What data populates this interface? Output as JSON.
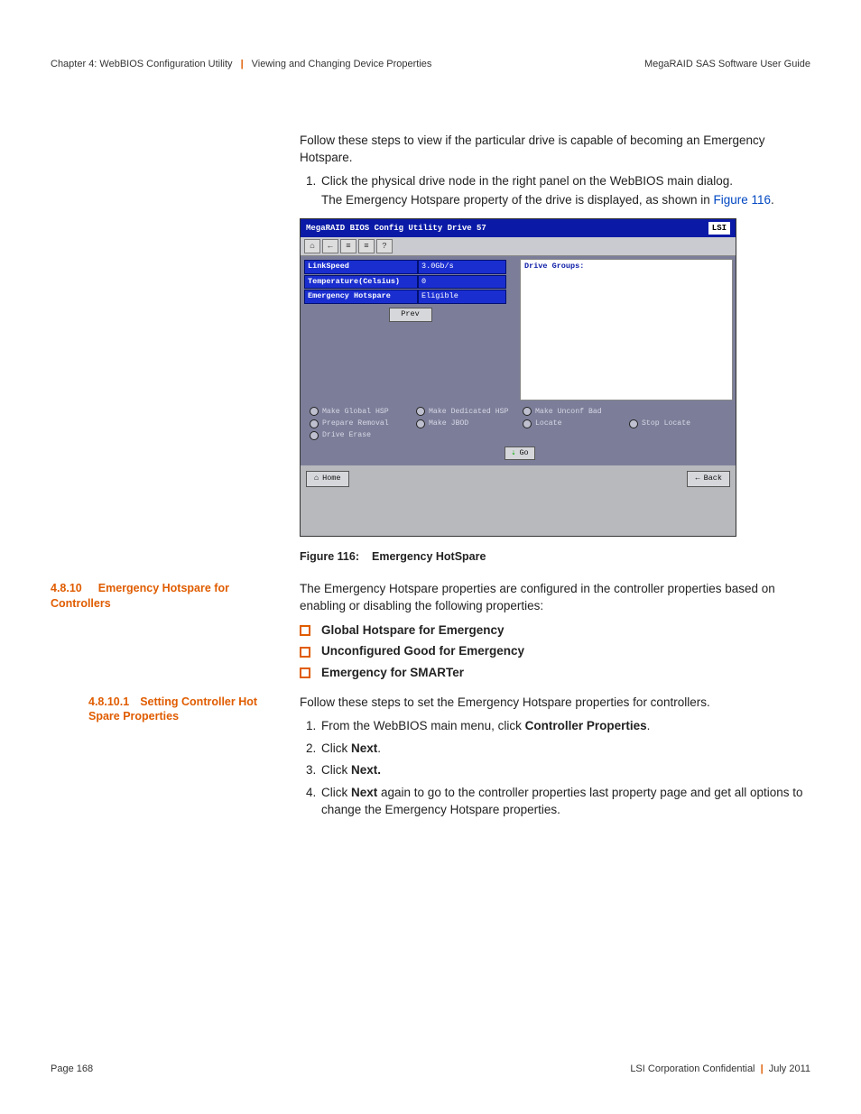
{
  "header": {
    "chapter": "Chapter 4: WebBIOS Configuration Utility",
    "section": "Viewing and Changing Device Properties",
    "doc_title": "MegaRAID SAS Software User Guide"
  },
  "intro": {
    "p1": "Follow these steps to view if the particular drive is capable of becoming an Emergency Hotspare.",
    "step1": "Click the physical drive node in the right panel on the WebBIOS main dialog.",
    "step1_after_a": "The Emergency Hotspare property of the drive is displayed, as shown in ",
    "step1_link": "Figure 116",
    "step1_after_b": "."
  },
  "shot": {
    "title": "MegaRAID BIOS Config Utility Drive 57",
    "brand": "LSI",
    "props": [
      {
        "k": "LinkSpeed",
        "v": "3.0Gb/s"
      },
      {
        "k": "Temperature(Celsius)",
        "v": "0"
      },
      {
        "k": "Emergency Hotspare",
        "v": "Eligible"
      }
    ],
    "prev": "Prev",
    "right_label": "Drive Groups:",
    "options": [
      "Make Global HSP",
      "Make Dedicated HSP",
      "Make Unconf Bad",
      "",
      "Prepare Removal",
      "Make JBOD",
      "Locate",
      "Stop Locate",
      "Drive Erase",
      "",
      "",
      ""
    ],
    "go": "Go",
    "home": "Home",
    "back": "Back"
  },
  "figure": {
    "label": "Figure 116:",
    "title": "Emergency HotSpare"
  },
  "sec4810": {
    "num": "4.8.10",
    "title": "Emergency Hotspare for Controllers",
    "p1": "The Emergency Hotspare properties are configured in the controller properties based on enabling or disabling the following properties:",
    "bullets": [
      "Global Hotspare for Emergency",
      "Unconfigured Good for Emergency",
      "Emergency for SMARTer"
    ]
  },
  "sec48101": {
    "num": "4.8.10.1",
    "title": "Setting Controller Hot Spare Properties",
    "p1": "Follow these steps to set the Emergency Hotspare properties for controllers.",
    "s1a": "From the WebBIOS main menu, click ",
    "s1b": "Controller Properties",
    "s1c": ".",
    "s2a": "Click ",
    "s2b": "Next",
    "s2c": ".",
    "s3a": "Click ",
    "s3b": "Next.",
    "s4a": "Click ",
    "s4b": "Next",
    "s4c": " again to go to the controller properties last property page and get all options to change the Emergency Hotspare properties."
  },
  "footer": {
    "page": "Page 168",
    "conf": "LSI Corporation Confidential",
    "date": "July 2011"
  }
}
